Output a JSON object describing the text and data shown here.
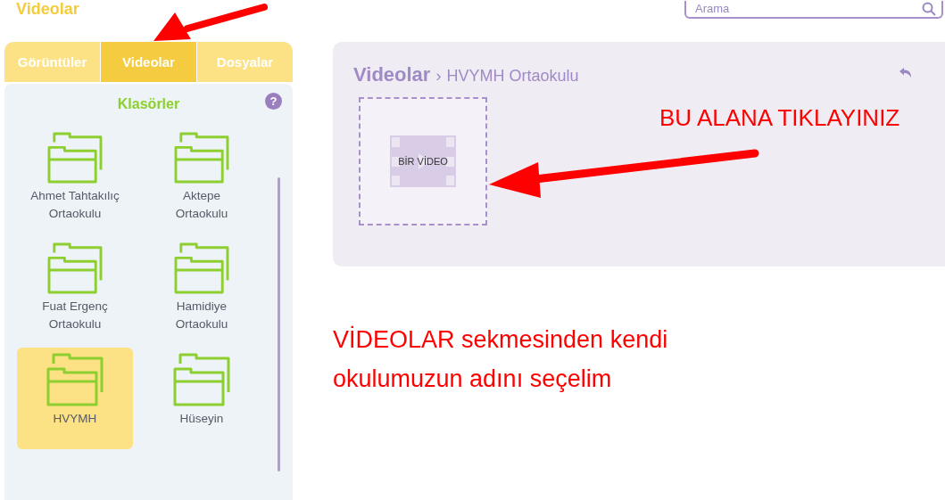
{
  "page_title": "Videolar",
  "search": {
    "placeholder": "Arama"
  },
  "tabs": [
    {
      "label": "Görüntüler",
      "selected": false
    },
    {
      "label": "Videolar",
      "selected": true
    },
    {
      "label": "Dosyalar",
      "selected": false
    }
  ],
  "folders_title": "Klasörler",
  "help": "?",
  "folders": [
    {
      "name": "Ahmet Tahtakılıç Ortaokulu",
      "selected": false
    },
    {
      "name": "Aktepe Ortaokulu",
      "selected": false
    },
    {
      "name": "Fuat Ergenç Ortaokulu",
      "selected": false
    },
    {
      "name": "Hamidiye Ortaokulu",
      "selected": false
    },
    {
      "name": "HVYMH",
      "selected": true
    },
    {
      "name": "Hüseyin",
      "selected": false
    }
  ],
  "breadcrumb": {
    "root": "Videolar",
    "separator": "›",
    "current": "HVYMH Ortaokulu"
  },
  "video_tile": {
    "label": "BİR VİDEO"
  },
  "annotations": [
    {
      "text": "BU ALANA TIKLAYINIZ"
    },
    {
      "text": "VİDEOLAR sekmesinden kendi okulumuzun adını seçelim"
    }
  ]
}
